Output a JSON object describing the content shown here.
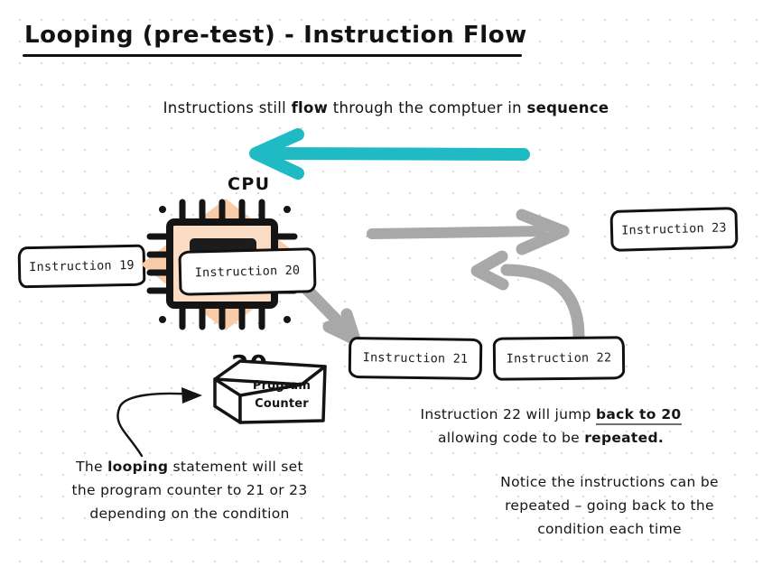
{
  "page": {
    "title": "Looping (pre-test) - Instruction Flow",
    "background": "#ffffff",
    "dot_grid_color": "#c9c9c9"
  },
  "subtitle": {
    "part1": "Instructions still ",
    "bold1": "flow",
    "part2": " through the comptuer in ",
    "bold2": "sequence"
  },
  "cpu": {
    "label": "CPU",
    "chip_color": "#111111",
    "diamond_color": "#F8CCA9",
    "chip_fill": "#FBDCC5"
  },
  "program_counter": {
    "value": "20",
    "line1": "Program",
    "line2": "Counter"
  },
  "instructions": [
    {
      "id": "19",
      "label": "Instruction 19"
    },
    {
      "id": "20",
      "label": "Instruction 20"
    },
    {
      "id": "21",
      "label": "Instruction 21"
    },
    {
      "id": "22",
      "label": "Instruction 22"
    },
    {
      "id": "23",
      "label": "Instruction 23"
    }
  ],
  "arrows": {
    "sequence_arrow_color": "#1FBAC4",
    "flow_arrow_color": "#A8A8A8",
    "pointer_arrow_color": "#111111",
    "sequence_arrow_name": "sequence-arrow-left",
    "flow_to_23_name": "flow-arrow-to-instruction-23",
    "flow_to_21_name": "flow-arrow-to-instruction-21",
    "jump_back_name": "jump-back-curved-arrow",
    "pc_pointer_name": "program-counter-pointer-arrow"
  },
  "notes": {
    "jump": {
      "line1_a": "Instruction 22 will jump ",
      "line1_underline": "back to 20",
      "line2_a": "allowing code to be ",
      "line2_bold": "repeated."
    },
    "program_counter": {
      "line1_a": "The ",
      "line1_bold": "looping",
      "line1_b": " statement will set",
      "line2": "the program counter to 21 or 23",
      "line3": "depending on the condition"
    },
    "notice": {
      "line1": "Notice the instructions can be",
      "line2": "repeated – going back to the",
      "line3": "condition each time"
    }
  }
}
